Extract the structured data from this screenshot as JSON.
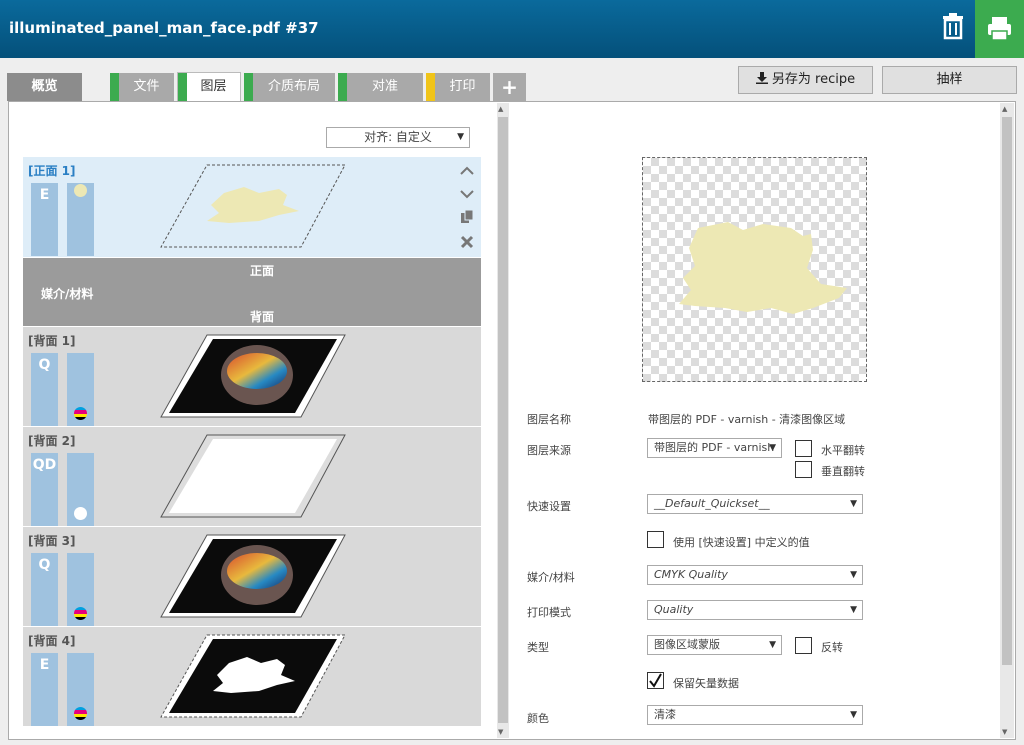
{
  "header": {
    "title": "illuminated_panel_man_face.pdf #37"
  },
  "tabs": [
    {
      "label": "概览",
      "color": ""
    },
    {
      "label": "文件",
      "color": "#3cab4f"
    },
    {
      "label": "图层",
      "color": "#3cab4f"
    },
    {
      "label": "介质布局",
      "color": "#3cab4f"
    },
    {
      "label": "对准",
      "color": "#3cab4f"
    },
    {
      "label": "打印",
      "color": "#f0c419"
    },
    {
      "label": "+",
      "color": ""
    }
  ],
  "actions": {
    "save_recipe": "另存为 recipe",
    "sample": "抽样"
  },
  "align_select": "对齐: 自定义",
  "front_section": {
    "layer": {
      "label": "[正面 1]",
      "code": "E"
    }
  },
  "media_section": {
    "front": "正面",
    "media": "媒介/材料",
    "back": "背面"
  },
  "back_layers": [
    {
      "label": "[背面 1]",
      "code": "Q",
      "dot": "cmyk"
    },
    {
      "label": "[背面 2]",
      "code": "QD",
      "dot": "white"
    },
    {
      "label": "[背面 3]",
      "code": "Q",
      "dot": "cmyk"
    },
    {
      "label": "[背面 4]",
      "code": "E",
      "dot": "cmyk"
    }
  ],
  "properties": {
    "layer_name_label": "图层名称",
    "layer_name_value": "带图层的 PDF - varnish - 清漆图像区域",
    "layer_source_label": "图层来源",
    "layer_source_value": "带图层的 PDF - varnish",
    "flip_h": "水平翻转",
    "flip_v": "垂直翻转",
    "quickset_label": "快速设置",
    "quickset_value": "__Default_Quickset__",
    "use_quickset": "使用 [快速设置] 中定义的值",
    "media_label": "媒介/材料",
    "media_value": "CMYK Quality",
    "print_mode_label": "打印模式",
    "print_mode_value": "Quality",
    "type_label": "类型",
    "type_value": "图像区域蒙版",
    "invert": "反转",
    "keep_vector": "保留矢量数据",
    "color_label": "颜色",
    "color_value": "清漆"
  }
}
